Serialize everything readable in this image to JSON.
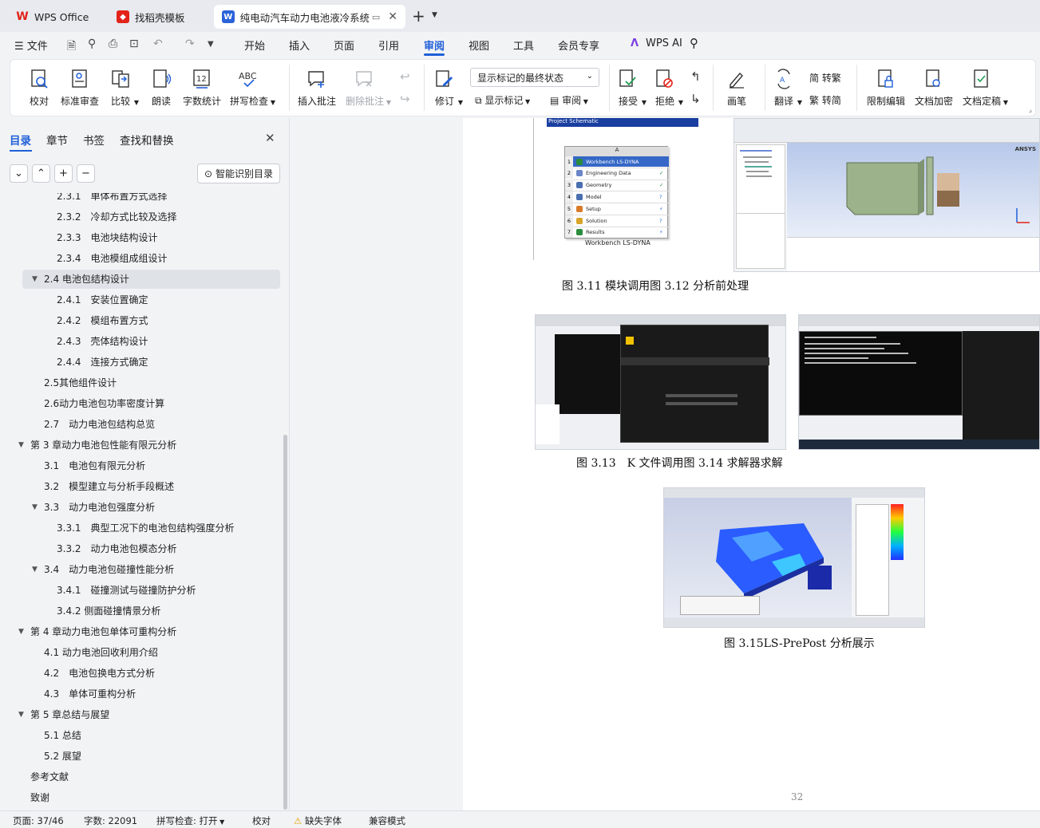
{
  "tabs": [
    {
      "label": "WPS Office"
    },
    {
      "label": "找稻壳模板"
    },
    {
      "label": "纯电动汽车动力电池液冷系统"
    }
  ],
  "menu": {
    "file": "文件",
    "items": [
      "开始",
      "插入",
      "页面",
      "引用",
      "审阅",
      "视图",
      "工具",
      "会员专享"
    ],
    "wps_ai": "WPS AI",
    "active": "审阅"
  },
  "ribbon": {
    "proofread": "校对",
    "std_review": "标准审查",
    "compare": "比较",
    "read_aloud": "朗读",
    "word_count": "字数统计",
    "spell_check": "拼写检查",
    "insert_comment": "插入批注",
    "delete_comment": "删除批注",
    "revise": "修订",
    "markup_state": "显示标记的最终状态",
    "show_markup": "显示标记",
    "review": "审阅",
    "accept": "接受",
    "reject": "拒绝",
    "pen": "画笔",
    "translate": "翻译",
    "to_trad": "简 转繁",
    "to_simp": "繁 转简",
    "restrict_edit": "限制编辑",
    "encrypt": "文档加密",
    "finalize": "文档定稿"
  },
  "nav": {
    "tabs": [
      "目录",
      "章节",
      "书签",
      "查找和替换"
    ],
    "active_tab": "目录",
    "smart_button": "智能识别目录"
  },
  "toc": [
    {
      "label": "2.3.1　单体布置方式选择",
      "level": 3
    },
    {
      "label": "2.3.2　冷却方式比较及选择",
      "level": 3
    },
    {
      "label": "2.3.3　电池块结构设计",
      "level": 3
    },
    {
      "label": "2.3.4　电池模组成组设计",
      "level": 3
    },
    {
      "label": "2.4 电池包结构设计",
      "level": 2,
      "expanded": true,
      "selected": true
    },
    {
      "label": "2.4.1　安装位置确定",
      "level": 3
    },
    {
      "label": "2.4.2　模组布置方式",
      "level": 3
    },
    {
      "label": "2.4.3　壳体结构设计",
      "level": 3
    },
    {
      "label": "2.4.4　连接方式确定",
      "level": 3
    },
    {
      "label": "2.5其他组件设计",
      "level": 2
    },
    {
      "label": "2.6动力电池包功率密度计算",
      "level": 2
    },
    {
      "label": "2.7　动力电池包结构总览",
      "level": 2
    },
    {
      "label": "第 3 章动力电池包性能有限元分析",
      "level": 1,
      "expanded": true
    },
    {
      "label": "3.1　电池包有限元分析",
      "level": 2
    },
    {
      "label": "3.2　模型建立与分析手段概述",
      "level": 2
    },
    {
      "label": "3.3　动力电池包强度分析",
      "level": 2,
      "expanded": true
    },
    {
      "label": "3.3.1　典型工况下的电池包结构强度分析",
      "level": 3
    },
    {
      "label": "3.3.2　动力电池包模态分析",
      "level": 3
    },
    {
      "label": "3.4　动力电池包碰撞性能分析",
      "level": 2,
      "expanded": true
    },
    {
      "label": "3.4.1　碰撞测试与碰撞防护分析",
      "level": 3
    },
    {
      "label": "3.4.2 侧面碰撞情景分析",
      "level": 3
    },
    {
      "label": "第 4 章动力电池包单体可重构分析",
      "level": 1,
      "expanded": true
    },
    {
      "label": "4.1 动力电池回收利用介绍",
      "level": 2
    },
    {
      "label": "4.2　电池包换电方式分析",
      "level": 2
    },
    {
      "label": "4.3　单体可重构分析",
      "level": 2
    },
    {
      "label": "第 5 章总结与展望",
      "level": 1,
      "expanded": true
    },
    {
      "label": "5.1 总结",
      "level": 2
    },
    {
      "label": "5.2 展望",
      "level": 2
    },
    {
      "label": "参考文献",
      "level": 1
    },
    {
      "label": "致谢",
      "level": 1
    }
  ],
  "doc": {
    "captions": [
      "图 3.11 模块调用图 3.12 分析前处理",
      "图 3.13　K 文件调用图 3.14 求解器求解",
      "图 3.15LS-PrePost 分析展示"
    ],
    "page_number": "32",
    "workbench": {
      "header": "Project Schematic",
      "col": "A",
      "rows": [
        "Workbench LS-DYNA",
        "Engineering Data",
        "Geometry",
        "Model",
        "Setup",
        "Solution",
        "Results"
      ],
      "caption": "Workbench LS-DYNA"
    },
    "ansys_logo": "ANSYS"
  },
  "status": {
    "page": "页面: 37/46",
    "words": "字数: 22091",
    "spell": "拼写检查: 打开",
    "proof": "校对",
    "missing_font": "缺失字体",
    "compat": "兼容模式"
  }
}
